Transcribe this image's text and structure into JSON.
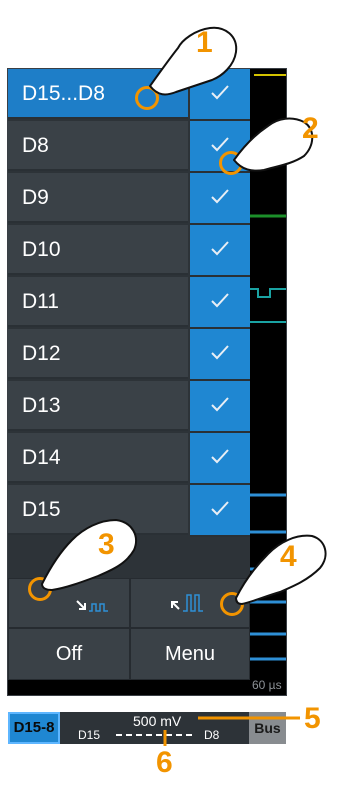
{
  "channels": [
    {
      "label": "D15...D8",
      "checked": true,
      "selected": true
    },
    {
      "label": "D8",
      "checked": true,
      "selected": false
    },
    {
      "label": "D9",
      "checked": true,
      "selected": false
    },
    {
      "label": "D10",
      "checked": true,
      "selected": false
    },
    {
      "label": "D11",
      "checked": true,
      "selected": false
    },
    {
      "label": "D12",
      "checked": true,
      "selected": false
    },
    {
      "label": "D13",
      "checked": true,
      "selected": false
    },
    {
      "label": "D14",
      "checked": true,
      "selected": false
    },
    {
      "label": "D15",
      "checked": true,
      "selected": false
    }
  ],
  "buttons": {
    "decrease_icon": "shrink-waveform-icon",
    "increase_icon": "expand-waveform-icon",
    "off_label": "Off",
    "menu_label": "Menu"
  },
  "waveform": {
    "time_label": "60 µs"
  },
  "status": {
    "bus_tag": "D15-8",
    "threshold": "500 mV",
    "range_start": "D15",
    "range_end": "D8",
    "bus_tab": "Bus"
  },
  "callouts": [
    "1",
    "2",
    "3",
    "4",
    "5",
    "6"
  ],
  "colors": {
    "accent_blue": "#1f87d2",
    "callout_orange": "#f29400",
    "panel_gray": "#3a4147"
  }
}
